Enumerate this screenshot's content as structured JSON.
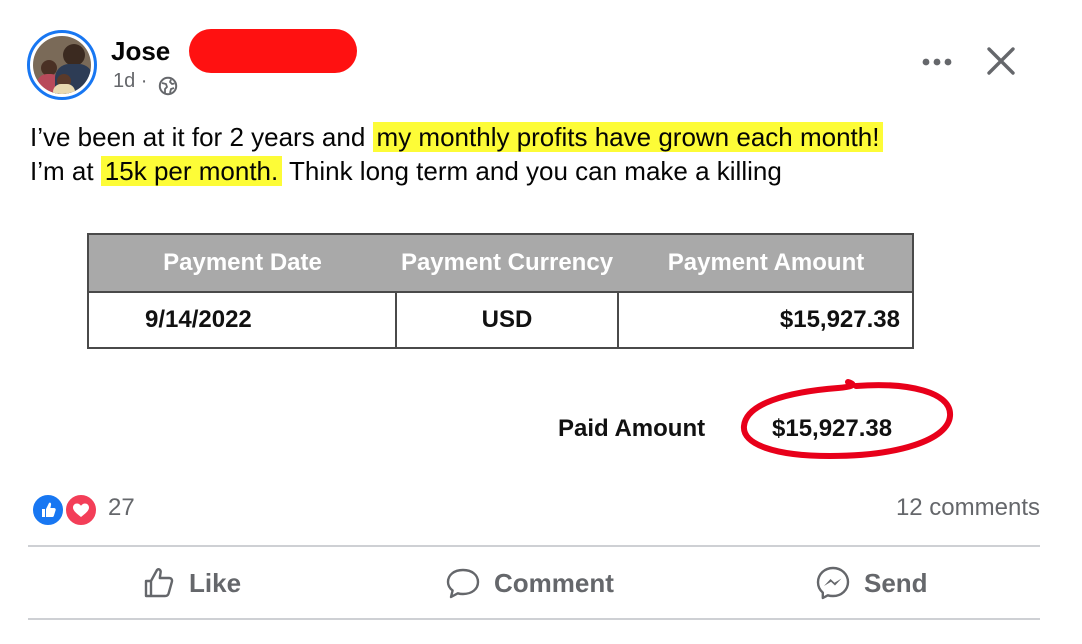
{
  "post": {
    "author": "Jose",
    "time": "1d ·",
    "text_parts": [
      "I’ve been at it for 2 years and ",
      "my monthly profits have grown each month!",
      "I’m at ",
      "15k per month.",
      " Think long term and you can make a killing"
    ]
  },
  "payment_table": {
    "headers": [
      "Payment Date",
      "Payment Currency",
      "Payment Amount"
    ],
    "row": [
      "9/14/2022",
      "USD",
      "$15,927.38"
    ],
    "paid_label": "Paid Amount",
    "paid_value": "$15,927.38"
  },
  "reactions": {
    "count": "27",
    "comments": "12 comments"
  },
  "actions": {
    "like": "Like",
    "comment": "Comment",
    "send": "Send"
  },
  "icons": {
    "more": "more-icon",
    "close": "close-icon",
    "privacy": "globe-icon",
    "like": "like-icon",
    "comment": "comment-icon",
    "send": "messenger-icon"
  },
  "colors": {
    "highlight": "#fdfc37",
    "accent": "#1877f2",
    "love": "#f33e58",
    "redaction": "#ff1111",
    "circle": "#e8001a"
  }
}
